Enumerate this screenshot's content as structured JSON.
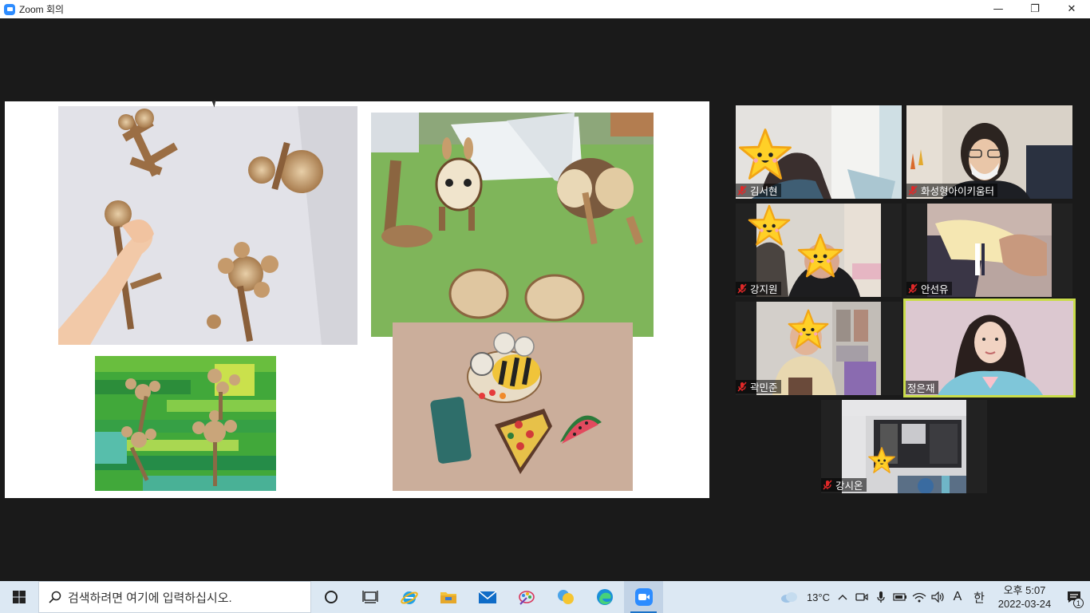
{
  "window": {
    "title": "Zoom 회의",
    "minimize": "—",
    "restore": "❐",
    "close": "✕"
  },
  "participants": [
    {
      "name": "김서현",
      "muted": true
    },
    {
      "name": "화성형아이키움터",
      "muted": true
    },
    {
      "name": "강지원",
      "muted": true
    },
    {
      "name": "안선유",
      "muted": true
    },
    {
      "name": "곽민준",
      "muted": true
    },
    {
      "name": "정은재",
      "muted": false,
      "active_speaker": true
    },
    {
      "name": "강시온",
      "muted": true
    }
  ],
  "taskbar": {
    "search_placeholder": "검색하려면 여기에 입력하십시오.",
    "apps": [
      "cortana-icon",
      "task-view-icon",
      "internet-explorer-icon",
      "file-explorer-icon",
      "mail-icon",
      "paint-icon",
      "chat-icon",
      "edge-icon",
      "zoom-icon"
    ],
    "weather": "13°C",
    "ime_a": "A",
    "ime_lang": "한",
    "time": "오후 5:07",
    "date": "2022-03-24",
    "notification_count": "1"
  },
  "colors": {
    "zoom_blue": "#2d8cff",
    "active_speaker": "#c9dc4a",
    "muted_red": "#e02828",
    "background": "#1a1a1a"
  }
}
